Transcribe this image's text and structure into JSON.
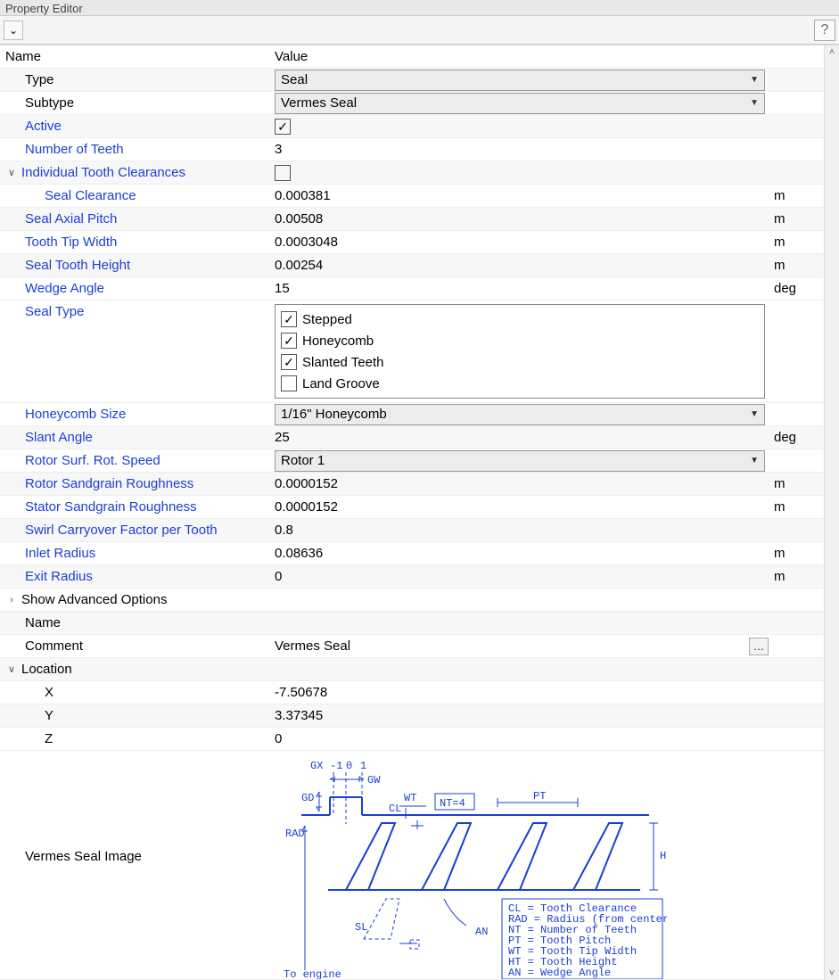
{
  "window": {
    "title": "Property Editor"
  },
  "headers": {
    "name": "Name",
    "value": "Value"
  },
  "props": {
    "type": {
      "label": "Type",
      "value": "Seal"
    },
    "subtype": {
      "label": "Subtype",
      "value": "Vermes Seal"
    },
    "active": {
      "label": "Active",
      "checked": true
    },
    "num_teeth": {
      "label": "Number of Teeth",
      "value": "3"
    },
    "indiv_clear": {
      "label": "Individual Tooth Clearances",
      "checked": false
    },
    "seal_clear": {
      "label": "Seal Clearance",
      "value": "0.000381",
      "unit": "m"
    },
    "axial_pitch": {
      "label": "Seal Axial Pitch",
      "value": "0.00508",
      "unit": "m"
    },
    "tip_width": {
      "label": "Tooth Tip Width",
      "value": "0.0003048",
      "unit": "m"
    },
    "tooth_height": {
      "label": "Seal Tooth Height",
      "value": "0.00254",
      "unit": "m"
    },
    "wedge_angle": {
      "label": "Wedge Angle",
      "value": "15",
      "unit": "deg"
    },
    "seal_type": {
      "label": "Seal Type",
      "options": [
        {
          "label": "Stepped",
          "checked": true
        },
        {
          "label": "Honeycomb",
          "checked": true
        },
        {
          "label": "Slanted Teeth",
          "checked": true
        },
        {
          "label": "Land Groove",
          "checked": false
        }
      ]
    },
    "honeycomb": {
      "label": "Honeycomb Size",
      "value": "1/16\" Honeycomb"
    },
    "slant_angle": {
      "label": "Slant Angle",
      "value": "25",
      "unit": "deg"
    },
    "rotor_speed": {
      "label": "Rotor Surf. Rot. Speed",
      "value": "Rotor 1"
    },
    "rotor_rough": {
      "label": "Rotor Sandgrain Roughness",
      "value": "0.0000152",
      "unit": "m"
    },
    "stator_rough": {
      "label": "Stator Sandgrain Roughness",
      "value": "0.0000152",
      "unit": "m"
    },
    "swirl": {
      "label": "Swirl Carryover Factor per Tooth",
      "value": "0.8"
    },
    "inlet_radius": {
      "label": "Inlet Radius",
      "value": "0.08636",
      "unit": "m"
    },
    "exit_radius": {
      "label": "Exit Radius",
      "value": "0",
      "unit": "m"
    },
    "adv": {
      "label": "Show Advanced Options"
    },
    "name": {
      "label": "Name",
      "value": ""
    },
    "comment": {
      "label": "Comment",
      "value": "Vermes Seal"
    },
    "location": {
      "label": "Location"
    },
    "x": {
      "label": "X",
      "value": "-7.50678"
    },
    "y": {
      "label": "Y",
      "value": "3.37345"
    },
    "z": {
      "label": "Z",
      "value": "0"
    },
    "image": {
      "label": "Vermes Seal Image"
    }
  },
  "diagram": {
    "gx_label": "GX",
    "gx_ticks": [
      "-1",
      "0",
      "1"
    ],
    "gw": "GW",
    "gd": "GD",
    "wt": "WT",
    "cl": "CL",
    "nt": "NT=4",
    "pt": "PT",
    "rad": "RAD",
    "ht": "HT",
    "sl": "SL",
    "an": "AN",
    "to_engine": "To engine",
    "legend": [
      "CL  = Tooth Clearance",
      "RAD = Radius (from centerline)",
      "NT  = Number of Teeth",
      "PT  = Tooth Pitch",
      "WT  = Tooth Tip Width",
      "HT  = Tooth Height",
      "AN  = Wedge Angle"
    ]
  }
}
